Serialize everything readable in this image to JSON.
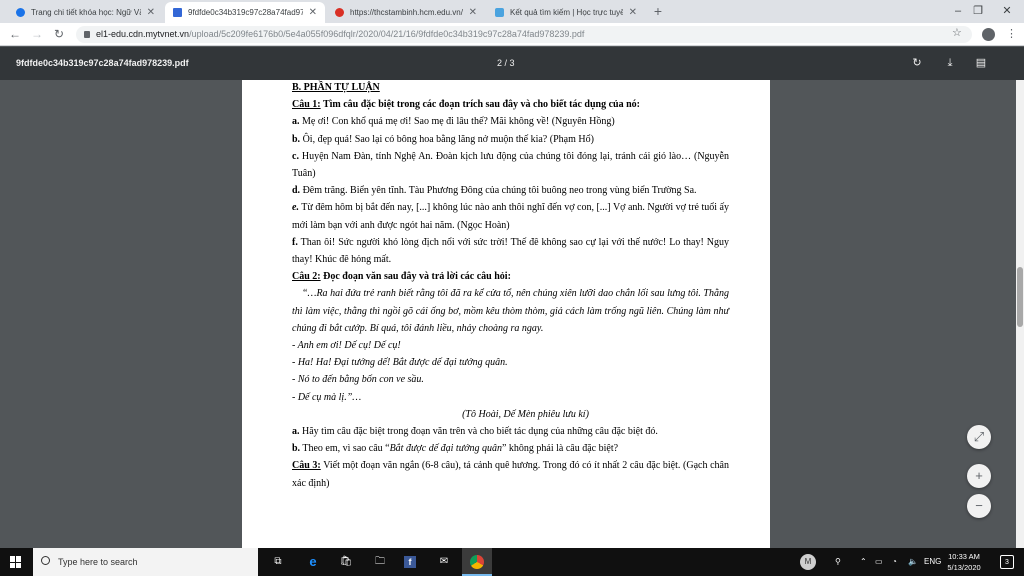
{
  "browser": {
    "tabs": [
      {
        "label": "Trang chi tiết khóa học: Ngữ Văn",
        "icon": "globe-icon"
      },
      {
        "label": "9fdfde0c34b319c97c28a74fad978239.pdf",
        "icon": "pdf-doc-icon"
      },
      {
        "label": "https://thcstambinh.hcm.edu.vn/",
        "icon": "school-icon"
      },
      {
        "label": "Kết quả tìm kiếm | Học trực tuyến",
        "icon": "cloud-icon"
      }
    ],
    "new_tab": "+",
    "window_controls": [
      "–",
      "❐",
      "✕"
    ],
    "url_domain": "el1-edu.cdn.mytvnet.vn",
    "url_path": "/upload/5c209fe6176b0/5e4a055f096dfqlr/2020/04/21/16/9fdfde0c34b319c97c28a74fad978239.pdf"
  },
  "pdf_toolbar": {
    "filename": "9fdfde0c34b319c97c28a74fad978239.pdf",
    "page_indicator": "2 / 3"
  },
  "document": {
    "section_title": "B. PHẦN TỰ LUẬN",
    "q1_label": "Câu 1:",
    "q1_text": " Tìm câu đặc biệt trong các đoạn trích sau đây và cho biết tác dụng của nó:",
    "q1_items": [
      {
        "k": "a.",
        "t": " Mẹ ơi! Con khổ quá mẹ ơi! Sao mẹ đi lâu thế? Mãi không về! (Nguyên Hồng)"
      },
      {
        "k": "b.",
        "t": " Ôi, đẹp quá! Sao lại có bông hoa bằng lăng nở muộn thế kia? (Phạm Hổ)"
      },
      {
        "k": "c.",
        "t": " Huyện Nam Đàn, tỉnh Nghệ An. Đoàn kịch lưu động của chúng tôi đóng lại, tránh cái gió lào… (Nguyễn Tuân)"
      },
      {
        "k": "d.",
        "t": " Đêm trăng. Biển yên tĩnh. Tàu Phương Đông của chúng tôi buông neo trong vùng biển Trường Sa."
      },
      {
        "k": "e.",
        "t": " Từ đêm hôm bị bắt đến nay, [...] không lúc nào anh thôi nghĩ đến vợ con, [...] Vợ anh. Người vợ trẻ tuổi ấy mới làm bạn với anh được ngót hai năm. (Ngọc Hoàn)"
      },
      {
        "k": "f.",
        "t": " Than ôi! Sức người khó lòng địch nổi với sức trời! Thế đê không sao cự lại với thế nước! Lo thay! Nguy thay! Khúc đê hỏng mất."
      }
    ],
    "q2_label": "Câu 2:",
    "q2_text": " Đọc đoạn văn sau đây và trả lời các câu hỏi:",
    "passage": "“…Ra hai đứa trẻ ranh biết rằng tôi đã ra kể cửa tổ, nên chúng xiên lưỡi dao chắn lối sau lưng tôi. Thằng thì làm việc, thằng thì ngồi gõ cái ống bơ, mồm kêu thòm thòm, giả cách làm trống ngũ liên. Chúng làm như chúng đi bắt cướp. Bí quá, tôi đánh liều, nhảy choàng ra ngay.",
    "dialogue": [
      "-  Anh em ơi! Dế cụ! Dế cụ!",
      "-  Ha! Ha! Đại tướng dế! Bắt được dế đại tướng quân.",
      "-  Nó to đến bằng bốn con ve sầu.",
      "-  Dế cụ mà lị.”…"
    ],
    "source": "(Tô Hoài, Dế Mèn phiêu lưu kí)",
    "q2_a_key": "a.",
    "q2_a": " Hãy tìm câu đặc biệt trong đoạn văn trên và cho biết tác dụng của những câu đặc biệt đó.",
    "q2_b_key": "b.",
    "q2_b_pre": " Theo em, vì sao câu “",
    "q2_b_quote": "Bắt được dế đại tướng quân",
    "q2_b_post": "” không phải là câu đặc biệt?",
    "q3_label": "Câu 3:",
    "q3_text": " Viết một đoạn văn ngắn (6-8 câu), tả cảnh quê hương. Trong đó có ít nhất 2 câu đặc biệt. (Gạch chân xác định)"
  },
  "taskbar": {
    "search_placeholder": "Type here to search",
    "language": "ENG",
    "time": "10:33 AM",
    "date": "5/13/2020",
    "notification_count": "3",
    "avatar_letter": "M"
  },
  "colors": {
    "tabbar_bg": "#dee1e6",
    "pdf_toolbar_bg": "#323639",
    "viewer_bg": "#525659",
    "taskbar_bg": "#101010"
  }
}
